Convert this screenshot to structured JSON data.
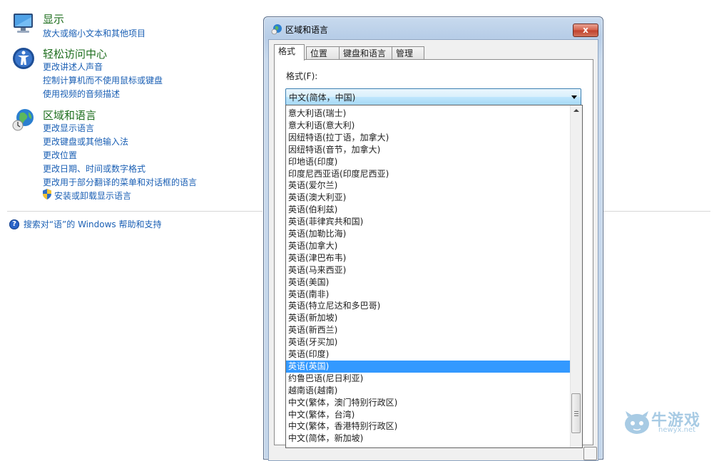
{
  "control_panel": {
    "display": {
      "title": "显示",
      "icon": "monitor-icon",
      "links": [
        "放大或缩小文本和其他项目"
      ]
    },
    "ease_of_access": {
      "title": "轻松访问中心",
      "icon": "ease-of-access-icon",
      "links": [
        "更改讲述人声音",
        "控制计算机而不使用鼠标或键盘",
        "使用视频的音频描述"
      ]
    },
    "region_language": {
      "title": "区域和语言",
      "icon": "globe-clock-icon",
      "links": [
        "更改显示语言",
        "更改键盘或其他输入法",
        "更改位置",
        "更改日期、时间或数字格式",
        "更改用于部分翻译的菜单和对话框的语言",
        "安装或卸载显示语言"
      ]
    },
    "help_link": "搜索对“语”的 Windows 帮助和支持"
  },
  "dialog": {
    "title": "区域和语言",
    "close_label": "x",
    "tabs": [
      "格式",
      "位置",
      "键盘和语言",
      "管理"
    ],
    "active_tab": "格式",
    "format_label": "格式(F):",
    "selected_format": "中文(简体，中国)",
    "dropdown_items": [
      "意大利语(瑞士)",
      "意大利语(意大利)",
      "因纽特语(拉丁语，加拿大)",
      "因纽特语(音节，加拿大)",
      "印地语(印度)",
      "印度尼西亚语(印度尼西亚)",
      "英语(爱尔兰)",
      "英语(澳大利亚)",
      "英语(伯利兹)",
      "英语(菲律宾共和国)",
      "英语(加勒比海)",
      "英语(加拿大)",
      "英语(津巴布韦)",
      "英语(马来西亚)",
      "英语(美国)",
      "英语(南非)",
      "英语(特立尼达和多巴哥)",
      "英语(新加坡)",
      "英语(新西兰)",
      "英语(牙买加)",
      "英语(印度)",
      "英语(英国)",
      "约鲁巴语(尼日利亚)",
      "越南语(越南)",
      "中文(繁体，澳门特别行政区)",
      "中文(繁体，台湾)",
      "中文(繁体，香港特别行政区)",
      "中文(简体，新加坡)"
    ],
    "highlighted_item": "英语(英国)",
    "scroll_position": 0.95
  },
  "watermark": {
    "main": "牛游戏",
    "sub": "newyx.net"
  },
  "colors": {
    "link": "#1a5fb4",
    "section_title": "#1e6e1e",
    "selection": "#3399ff",
    "dialog_frame": "#c4d6ea"
  }
}
